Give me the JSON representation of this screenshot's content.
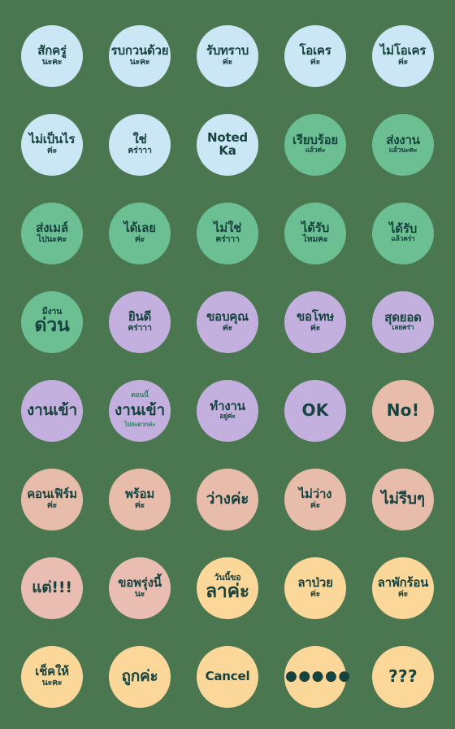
{
  "sheet": {
    "background_color": "#4a7650",
    "columns": 5,
    "rows": 8,
    "palette": {
      "blue": "#cbe7f5",
      "green": "#6cbf92",
      "purple": "#c3b0de",
      "peach": "#e8bcaa",
      "pink": "#e9bdb2",
      "orange": "#fbd79a",
      "text_dark": "#17433f",
      "text_green": "#2f8a63",
      "background": "#4a7650"
    }
  },
  "stickers": [
    {
      "id": 1,
      "color": "blue",
      "main": "สักครู่",
      "sub": "นะคะ"
    },
    {
      "id": 2,
      "color": "blue",
      "main": "รบกวนด้วย",
      "sub": "นะคะ"
    },
    {
      "id": 3,
      "color": "blue",
      "main": "รับทราบ",
      "sub": "ค่ะ"
    },
    {
      "id": 4,
      "color": "blue",
      "main": "โอเคร",
      "sub": "ค่ะ"
    },
    {
      "id": 5,
      "color": "blue",
      "main": "ไม่โอเคร",
      "sub": "ค่ะ"
    },
    {
      "id": 6,
      "color": "blue",
      "main": "ไม่เป็นไร",
      "sub": "ค่ะ"
    },
    {
      "id": 7,
      "color": "blue",
      "main": "ใช่",
      "sub": "คร่าาา"
    },
    {
      "id": 8,
      "color": "blue",
      "main": "Noted",
      "sub": "Ka",
      "latin": true
    },
    {
      "id": 9,
      "color": "green",
      "main": "เรียบร้อย",
      "sub": "แล้วค่ะ"
    },
    {
      "id": 10,
      "color": "green",
      "main": "ส่งงาน",
      "sub": "แล้วนะคะ"
    },
    {
      "id": 11,
      "color": "green",
      "main": "ส่งเมล์",
      "sub": "ไปนะคะ"
    },
    {
      "id": 12,
      "color": "green",
      "main": "ได้เลย",
      "sub": "ค่ะ"
    },
    {
      "id": 13,
      "color": "green",
      "main": "ไม่ใช่",
      "sub": "คร่าาา"
    },
    {
      "id": 14,
      "color": "green",
      "main": "ได้รับ",
      "sub": "ไหมคะ"
    },
    {
      "id": 15,
      "color": "green",
      "main": "ได้รับ",
      "sub": "แล้วคร่า"
    },
    {
      "id": 16,
      "color": "green",
      "main": "มีงาน",
      "sub": "ด่วน",
      "emphasis": "sub"
    },
    {
      "id": 17,
      "color": "purple",
      "main": "ยินดี",
      "sub": "คร่าาา"
    },
    {
      "id": 18,
      "color": "purple",
      "main": "ขอบคุณ",
      "sub": "ค่ะ"
    },
    {
      "id": 19,
      "color": "purple",
      "main": "ขอโทษ",
      "sub": "ค่ะ"
    },
    {
      "id": 20,
      "color": "purple",
      "main": "สุดยอด",
      "sub": "เลยคร่า"
    },
    {
      "id": 21,
      "color": "purple",
      "main": "งานเข้า"
    },
    {
      "id": 22,
      "color": "purple",
      "over": "ตอนนี้",
      "main": "งานเข้า",
      "under": "ไม่สะดวกค่ะ"
    },
    {
      "id": 23,
      "color": "purple",
      "main": "ทำงาน",
      "sub": "อยู่ค่ะ"
    },
    {
      "id": 24,
      "color": "purple",
      "main": "OK",
      "latin": true
    },
    {
      "id": 25,
      "color": "peach",
      "main": "No!",
      "latin": true
    },
    {
      "id": 26,
      "color": "peach",
      "main": "คอนเฟิร์ม",
      "sub": "ค่ะ"
    },
    {
      "id": 27,
      "color": "peach",
      "main": "พร้อม",
      "sub": "ค่ะ"
    },
    {
      "id": 28,
      "color": "peach",
      "main": "ว่างค่ะ"
    },
    {
      "id": 29,
      "color": "peach",
      "main": "ไม่ว่าง",
      "sub": "ค่ะ"
    },
    {
      "id": 30,
      "color": "peach",
      "main": "ไม่รีบๆ"
    },
    {
      "id": 31,
      "color": "pink",
      "main": "แต่!!!"
    },
    {
      "id": 32,
      "color": "pink",
      "main": "ขอพรุ่งนี้",
      "sub": "นะ"
    },
    {
      "id": 33,
      "color": "orange",
      "main": "วันนี้ขอ",
      "sub": "ลาค่ะ",
      "emphasis": "sub"
    },
    {
      "id": 34,
      "color": "orange",
      "main": "ลาป่วย",
      "sub": "ค่ะ"
    },
    {
      "id": 35,
      "color": "orange",
      "main": "ลาพักร้อน",
      "sub": "ค่ะ"
    },
    {
      "id": 36,
      "color": "orange",
      "main": "เช็คให้",
      "sub": "นะคะ"
    },
    {
      "id": 37,
      "color": "orange",
      "main": "ถูกค่ะ"
    },
    {
      "id": 38,
      "color": "orange",
      "main": "Cancel",
      "latin": true
    },
    {
      "id": 39,
      "color": "orange",
      "main": "●●●●●",
      "dots": true
    },
    {
      "id": 40,
      "color": "orange",
      "main": "???",
      "latin": true
    }
  ]
}
